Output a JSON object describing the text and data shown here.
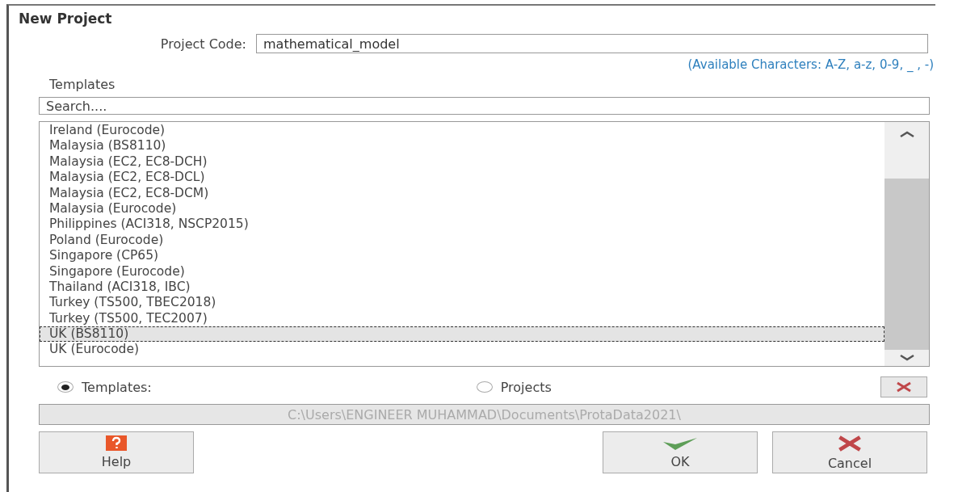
{
  "window": {
    "title": "New Project"
  },
  "project_code": {
    "label": "Project Code:",
    "value": "mathematical_model",
    "hint": "(Available Characters: A-Z, a-z, 0-9, _ , -)"
  },
  "templates": {
    "label": "Templates",
    "search": {
      "placeholder": "Search...."
    },
    "items": [
      {
        "label": "Ireland (Eurocode)",
        "selected": false
      },
      {
        "label": "Malaysia (BS8110)",
        "selected": false
      },
      {
        "label": "Malaysia (EC2, EC8-DCH)",
        "selected": false
      },
      {
        "label": "Malaysia (EC2, EC8-DCL)",
        "selected": false
      },
      {
        "label": "Malaysia (EC2, EC8-DCM)",
        "selected": false
      },
      {
        "label": "Malaysia (Eurocode)",
        "selected": false
      },
      {
        "label": "Philippines (ACI318, NSCP2015)",
        "selected": false
      },
      {
        "label": "Poland (Eurocode)",
        "selected": false
      },
      {
        "label": "Singapore (CP65)",
        "selected": false
      },
      {
        "label": "Singapore (Eurocode)",
        "selected": false
      },
      {
        "label": "Thailand (ACI318, IBC)",
        "selected": false
      },
      {
        "label": "Turkey (TS500, TBEC2018)",
        "selected": false
      },
      {
        "label": "Turkey (TS500, TEC2007)",
        "selected": false
      },
      {
        "label": "UK (BS8110)",
        "selected": true
      },
      {
        "label": "UK (Eurocode)",
        "selected": false
      }
    ]
  },
  "source": [
    {
      "label": "Templates:",
      "selected": true
    },
    {
      "label": "Projects",
      "selected": false
    }
  ],
  "path": {
    "value": "C:\\Users\\ENGINEER MUHAMMAD\\Documents\\ProtaData2021\\",
    "disabled": true
  },
  "buttons": [
    {
      "kind": "help",
      "label": "Help"
    },
    {
      "kind": "ok",
      "label": "OK"
    },
    {
      "kind": "cancel",
      "label": "Cancel"
    }
  ]
}
